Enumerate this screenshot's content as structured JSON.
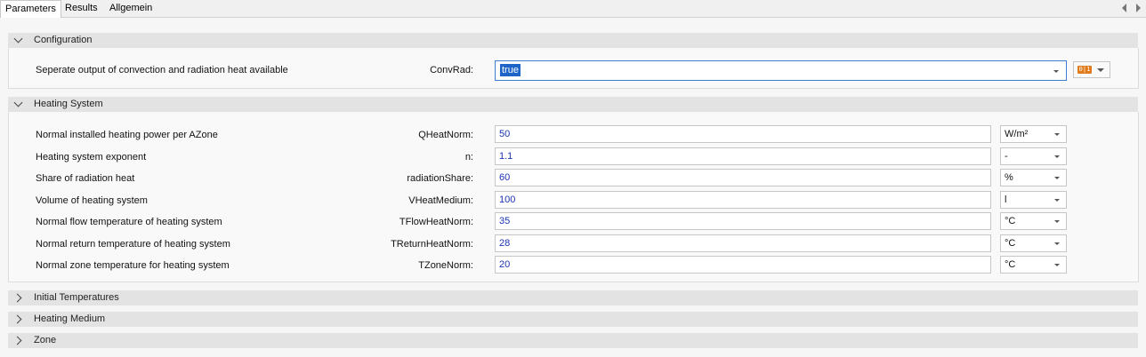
{
  "tabs": [
    "Parameters",
    "Results",
    "Allgemein"
  ],
  "configuration": {
    "title": "Configuration",
    "label": "Seperate output of convection and radiation heat available",
    "key": "ConvRad:",
    "value": "true"
  },
  "heating_system": {
    "title": "Heating System",
    "rows": [
      {
        "label": "Normal installed heating power per AZone",
        "key": "QHeatNorm:",
        "value": "50",
        "unit": "W/m²"
      },
      {
        "label": "Heating system exponent",
        "key": "n:",
        "value": "1.1",
        "unit": "-"
      },
      {
        "label": "Share of radiation heat",
        "key": "radiationShare:",
        "value": "60",
        "unit": "%"
      },
      {
        "label": "Volume of heating system",
        "key": "VHeatMedium:",
        "value": "100",
        "unit": "l"
      },
      {
        "label": "Normal flow temperature of heating system",
        "key": "TFlowHeatNorm:",
        "value": "35",
        "unit": "°C"
      },
      {
        "label": "Normal return temperature of heating system",
        "key": "TReturnHeatNorm:",
        "value": "28",
        "unit": "°C"
      },
      {
        "label": "Normal zone temperature for heating system",
        "key": "TZoneNorm:",
        "value": "20",
        "unit": "°C"
      }
    ]
  },
  "collapsed_sections": [
    "Initial Temperatures",
    "Heating Medium",
    "Zone"
  ],
  "colors": {
    "accent": "#1e63c8",
    "value_text": "#1a33b3",
    "tool_icon": "#e07a1a"
  }
}
